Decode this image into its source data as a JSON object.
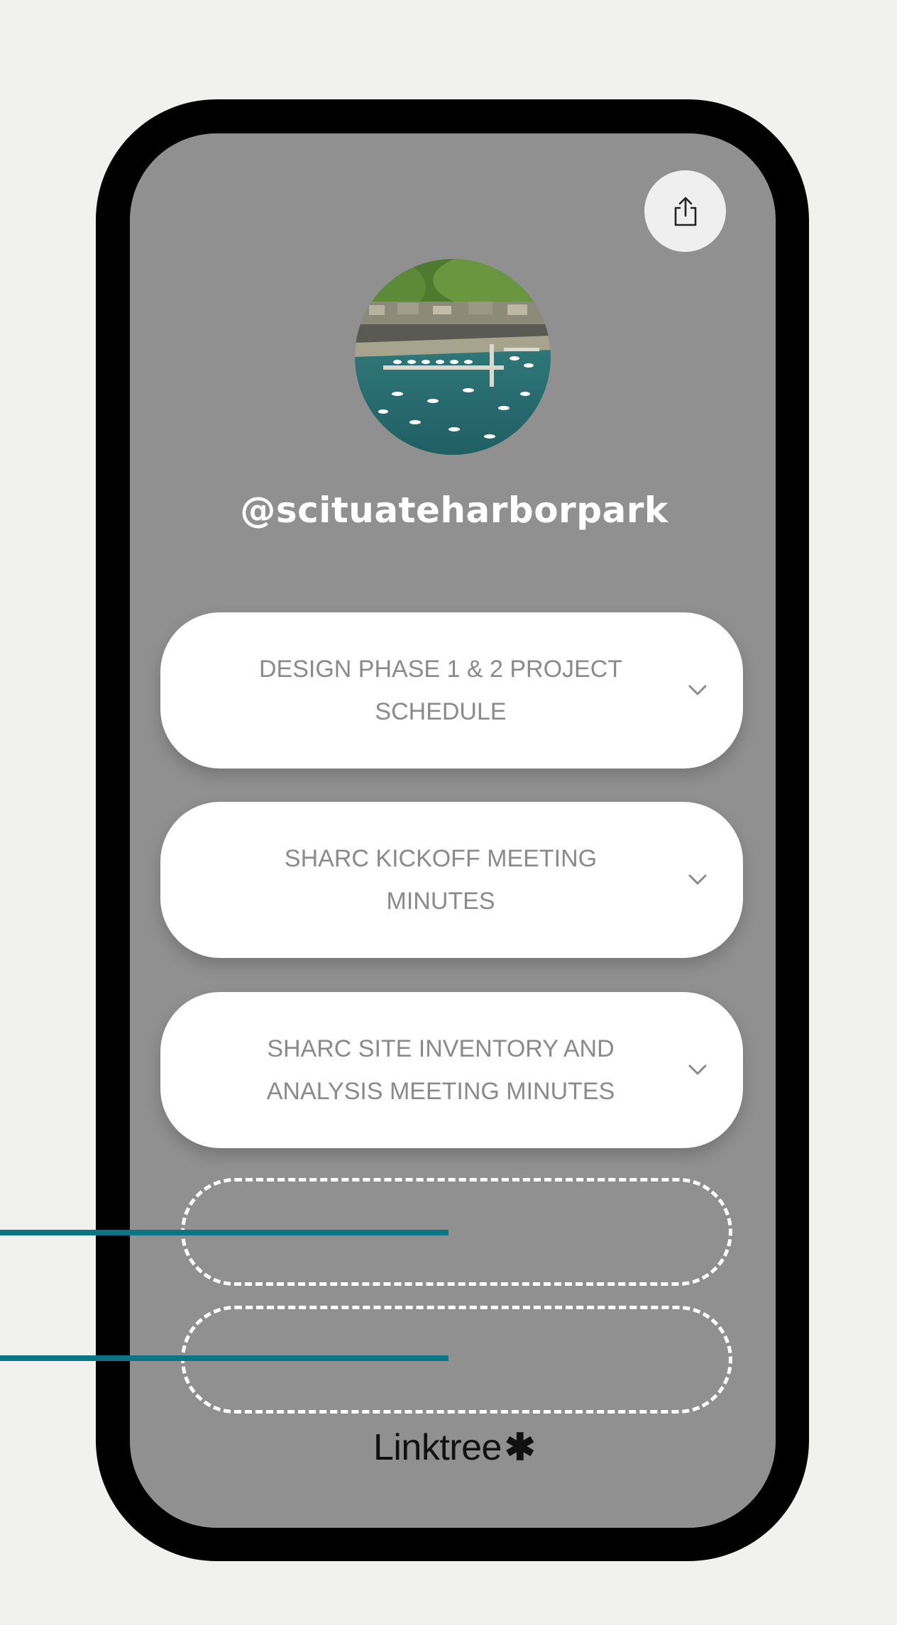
{
  "profile": {
    "username": "@scituateharborpark",
    "avatar_icon": "harbor-photo-avatar"
  },
  "header": {
    "share_icon": "share-icon"
  },
  "links": [
    {
      "label": "DESIGN PHASE 1 & 2 PROJECT SCHEDULE",
      "icon": "chevron-down-icon"
    },
    {
      "label": "SHARC KICKOFF MEETING MINUTES",
      "icon": "chevron-down-icon"
    },
    {
      "label": "SHARC SITE INVENTORY AND ANALYSIS MEETING MINUTES",
      "icon": "chevron-down-icon"
    }
  ],
  "footer": {
    "brand": "Linktree",
    "brand_mark": "✱"
  },
  "colors": {
    "page_background": "#f1f1ef",
    "phone_frame": "#000000",
    "screen_background": "#909090",
    "button_background": "#ffffff",
    "button_text": "#8a8a8a",
    "callout_line": "#0e7385",
    "placeholder_outline": "#ffffff"
  }
}
